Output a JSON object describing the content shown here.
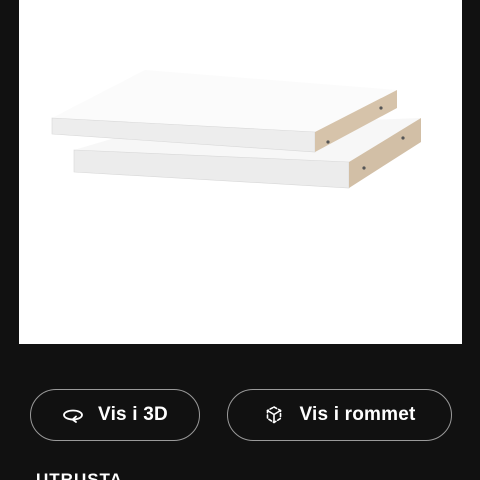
{
  "product_image": {
    "icon": "white-shelves-image"
  },
  "buttons": {
    "view_3d": {
      "label": "Vis i 3D",
      "icon": "rotate-3d-icon"
    },
    "view_room": {
      "label": "Vis i rommet",
      "icon": "augmented-reality-icon"
    }
  },
  "section": {
    "heading": "UTRUSTA"
  },
  "colors": {
    "background": "#111111",
    "image_panel": "#ffffff",
    "button_border": "#9a9a9a",
    "text": "#ffffff"
  }
}
